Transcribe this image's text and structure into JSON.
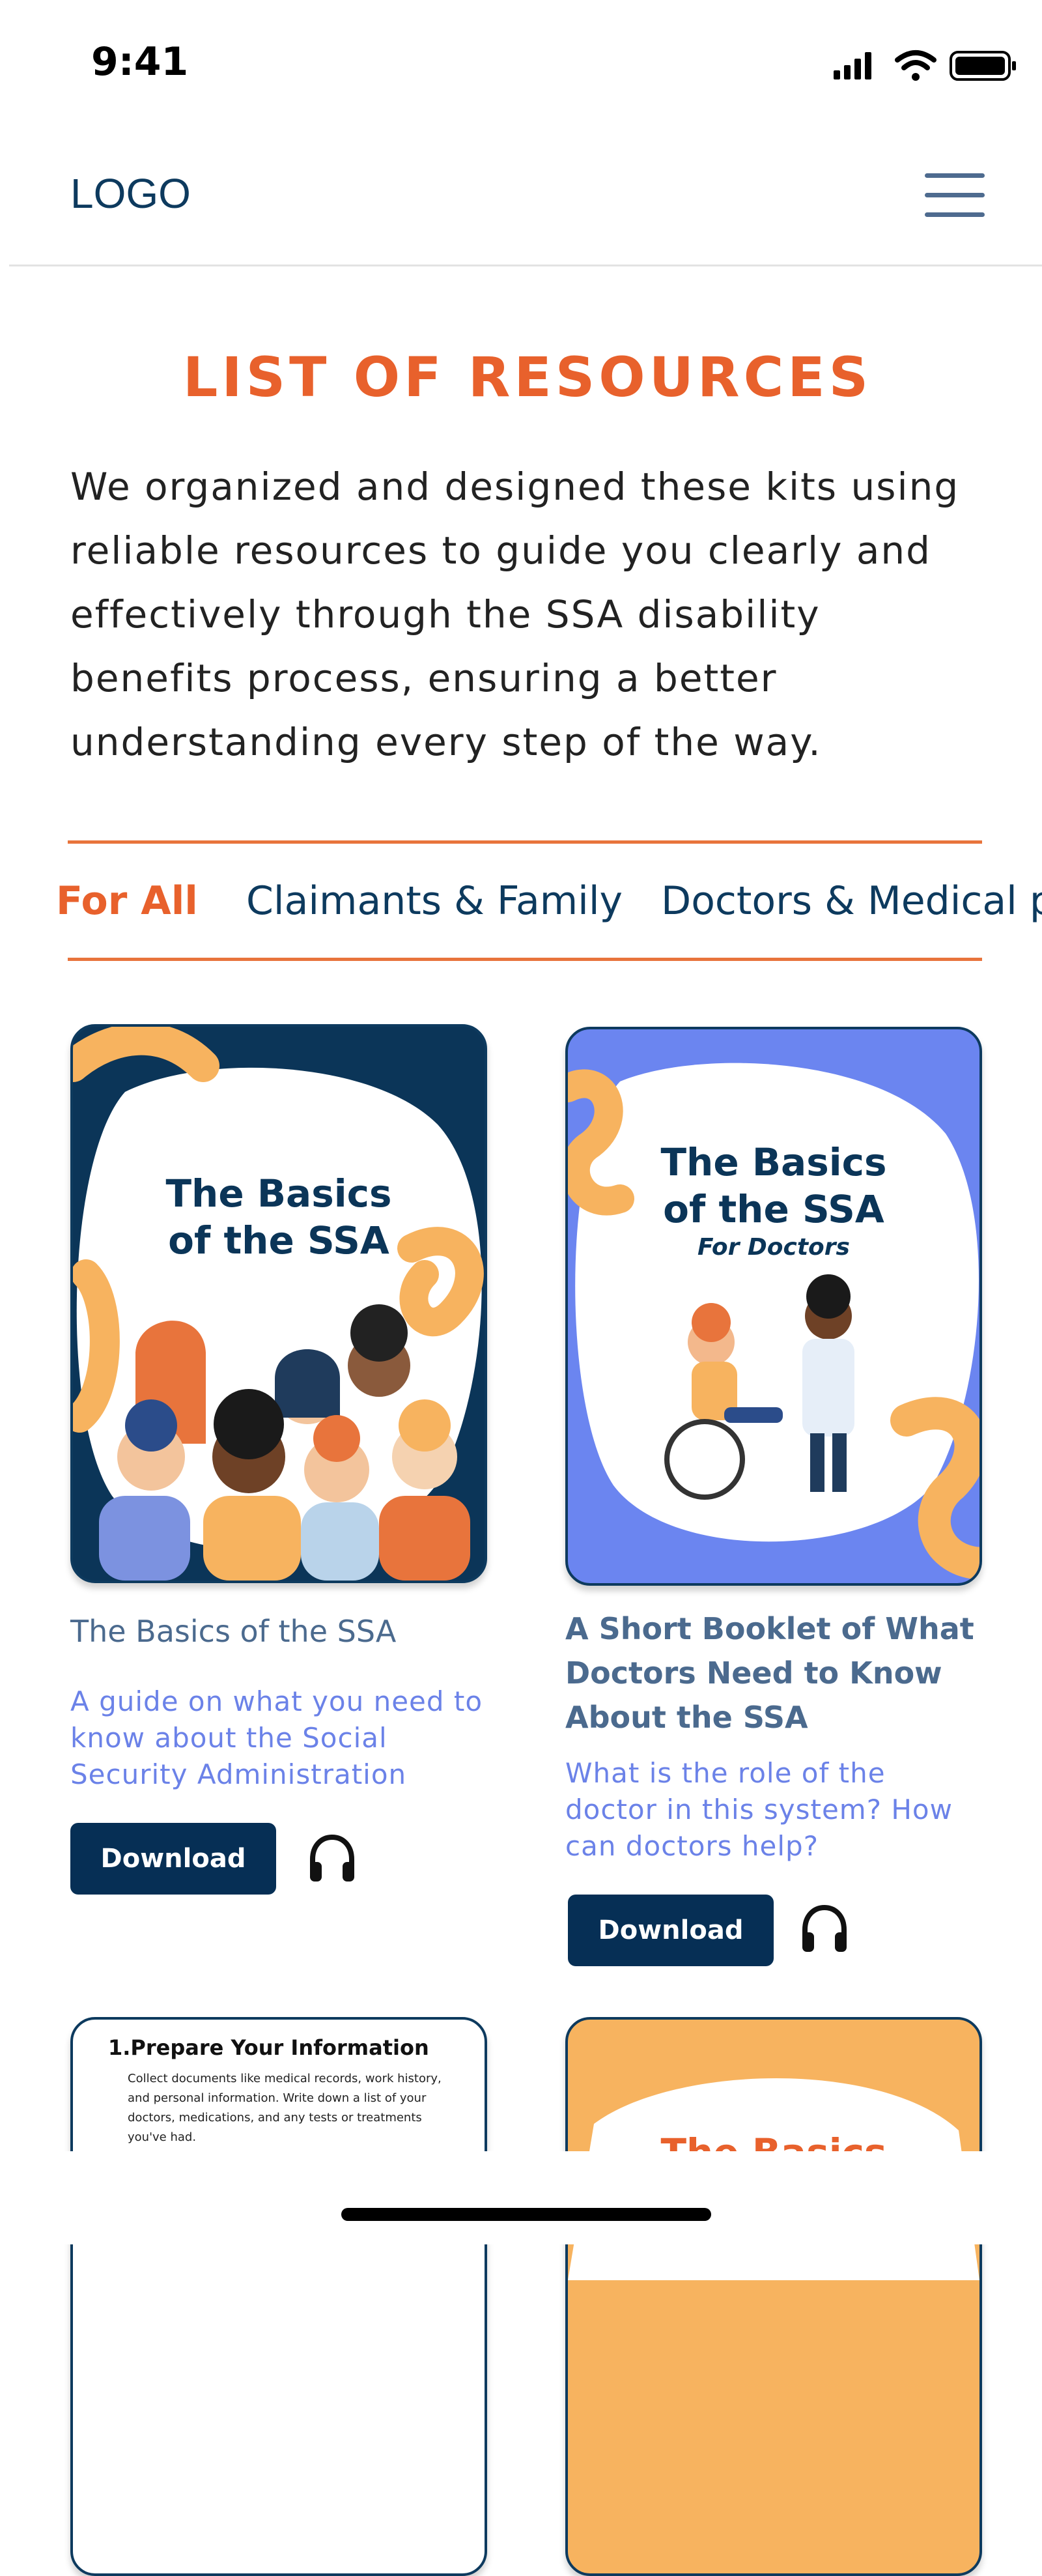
{
  "status_bar": {
    "time": "9:41"
  },
  "header": {
    "logo": "LOGO"
  },
  "page": {
    "title": "LIST OF RESOURCES",
    "intro_lines": [
      "We organized and designed these kits using",
      "reliable resources to guide you clearly and",
      "effectively through the SSA disability",
      "benefits process, ensuring a better",
      "understanding every step of the way."
    ]
  },
  "tabs": [
    {
      "label": "For All",
      "active": true
    },
    {
      "label": "Claimants & Family",
      "active": false
    },
    {
      "label": "Doctors & Medical pr",
      "active": false
    }
  ],
  "cards": [
    {
      "cover_title_lines": [
        "The Basics",
        "of the SSA"
      ],
      "title_lines": [
        "The Basics of the SSA"
      ],
      "description_lines": [
        "A guide on what you need to",
        "know about the Social",
        "Security Administration"
      ],
      "button_label": "Download"
    },
    {
      "cover_title_lines": [
        "The Basics",
        "of the SSA"
      ],
      "cover_subtitle": "For Doctors",
      "title_lines": [
        "A Short Booklet of What",
        "Doctors Need to Know",
        "About the SSA"
      ],
      "description_lines": [
        "What is the role of the",
        "doctor in this system? How",
        "can doctors help?"
      ],
      "button_label": "Download"
    },
    {
      "cover_heading": "1.Prepare Your Information",
      "cover_text_lines": [
        "Collect documents like medical records, work history,",
        "and personal information. Write down a list of your",
        "doctors, medications, and any tests or treatments",
        "you've had."
      ]
    },
    {
      "cover_title_partial": "The Basics"
    }
  ],
  "colors": {
    "accent_orange": "#e8612c",
    "navy": "#062f55",
    "link_blue": "#6b82e8",
    "periwinkle": "#6b85f0",
    "cover_orange": "#f7b35f"
  },
  "icons": [
    "signal-icon",
    "wifi-icon",
    "battery-icon",
    "hamburger-menu-icon",
    "headphones-icon"
  ]
}
